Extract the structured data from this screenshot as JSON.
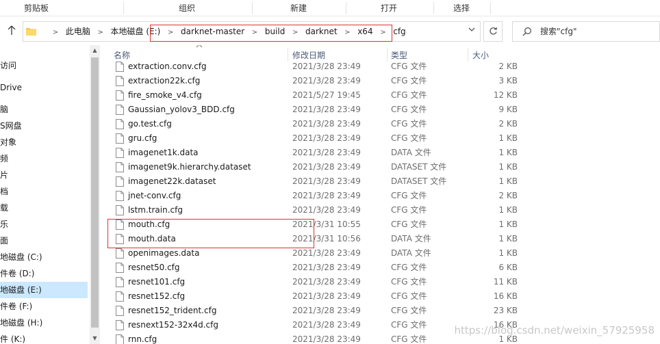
{
  "ribbon": {
    "groups": [
      "剪贴板",
      "组织",
      "新建",
      "打开",
      "选择"
    ]
  },
  "address": {
    "crumbs": [
      "此电脑",
      "本地磁盘 (E:)",
      "darknet-master",
      "build",
      "darknet",
      "x64",
      "cfg"
    ],
    "search_placeholder": "搜索\"cfg\""
  },
  "nav": {
    "items": [
      {
        "label": "访问"
      },
      {
        "label": "Drive"
      },
      {
        "label": "脑"
      },
      {
        "label": "S网盘"
      },
      {
        "label": "对象"
      },
      {
        "label": "频"
      },
      {
        "label": "片"
      },
      {
        "label": "档"
      },
      {
        "label": "载"
      },
      {
        "label": "乐"
      },
      {
        "label": "面"
      },
      {
        "label": "地磁盘 (C:)"
      },
      {
        "label": "件卷 (D:)"
      },
      {
        "label": "地磁盘 (E:)",
        "selected": true
      },
      {
        "label": "件卷 (F:)"
      },
      {
        "label": "地磁盘 (H:)"
      },
      {
        "label": "件 (K:)"
      }
    ]
  },
  "columns": {
    "name": "名称",
    "date": "修改日期",
    "type": "类型",
    "size": "大小"
  },
  "files": [
    {
      "name": "extraction.conv.cfg",
      "date": "2021/3/28 23:49",
      "type": "CFG 文件",
      "size": "2 KB"
    },
    {
      "name": "extraction22k.cfg",
      "date": "2021/3/28 23:49",
      "type": "CFG 文件",
      "size": "3 KB"
    },
    {
      "name": "fire_smoke_v4.cfg",
      "date": "2021/5/27 19:45",
      "type": "CFG 文件",
      "size": "12 KB"
    },
    {
      "name": "Gaussian_yolov3_BDD.cfg",
      "date": "2021/3/28 23:49",
      "type": "CFG 文件",
      "size": "9 KB"
    },
    {
      "name": "go.test.cfg",
      "date": "2021/3/28 23:49",
      "type": "CFG 文件",
      "size": "2 KB"
    },
    {
      "name": "gru.cfg",
      "date": "2021/3/28 23:49",
      "type": "CFG 文件",
      "size": "1 KB"
    },
    {
      "name": "imagenet1k.data",
      "date": "2021/3/28 23:49",
      "type": "DATA 文件",
      "size": "1 KB"
    },
    {
      "name": "imagenet9k.hierarchy.dataset",
      "date": "2021/3/28 23:49",
      "type": "DATASET 文件",
      "size": "1 KB"
    },
    {
      "name": "imagenet22k.dataset",
      "date": "2021/3/28 23:49",
      "type": "DATASET 文件",
      "size": "1 KB"
    },
    {
      "name": "jnet-conv.cfg",
      "date": "2021/3/28 23:49",
      "type": "CFG 文件",
      "size": "2 KB"
    },
    {
      "name": "lstm.train.cfg",
      "date": "2021/3/28 23:49",
      "type": "CFG 文件",
      "size": "1 KB"
    },
    {
      "name": "mouth.cfg",
      "date": "2021/3/31 10:55",
      "type": "CFG 文件",
      "size": "1 KB"
    },
    {
      "name": "mouth.data",
      "date": "2021/3/31 10:56",
      "type": "DATA 文件",
      "size": "1 KB"
    },
    {
      "name": "openimages.data",
      "date": "2021/3/28 23:49",
      "type": "DATA 文件",
      "size": "1 KB"
    },
    {
      "name": "resnet50.cfg",
      "date": "2021/3/28 23:49",
      "type": "CFG 文件",
      "size": "6 KB"
    },
    {
      "name": "resnet101.cfg",
      "date": "2021/3/28 23:49",
      "type": "CFG 文件",
      "size": "11 KB"
    },
    {
      "name": "resnet152.cfg",
      "date": "2021/3/28 23:49",
      "type": "CFG 文件",
      "size": "16 KB"
    },
    {
      "name": "resnet152_trident.cfg",
      "date": "2021/3/28 23:49",
      "type": "CFG 文件",
      "size": "23 KB"
    },
    {
      "name": "resnext152-32x4d.cfg",
      "date": "2021/3/28 23:49",
      "type": "CFG 文件",
      "size": "16 KB"
    },
    {
      "name": "rnn.cfg",
      "date": "2021/3/28 23:49",
      "type": "CFG 文件",
      "size": "1 KB"
    }
  ],
  "watermark": "https://blog.csdn.net/weixin_57925958",
  "colors": {
    "annotation_red": "#e03030",
    "selected_nav": "#cce8ff",
    "folder_yellow": "#f4c84e"
  },
  "icons": [
    "up-arrow-icon",
    "folder-icon",
    "chevron-right-icon",
    "chevron-down-icon",
    "refresh-icon",
    "search-icon",
    "file-icon",
    "sort-up-icon"
  ]
}
